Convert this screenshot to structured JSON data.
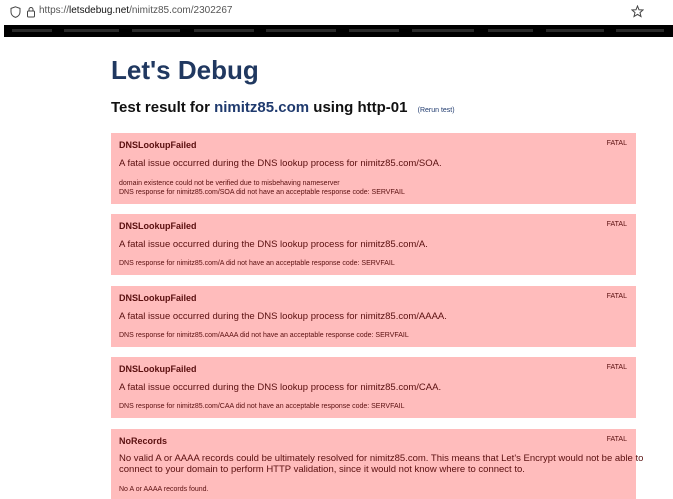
{
  "browser": {
    "url_prefix": "https://",
    "url_host": "letsdebug.net",
    "url_path": "/nimitz85.com/2302267"
  },
  "page": {
    "title": "Let's Debug",
    "subtitle_prefix": "Test result for",
    "domain": "nimitz85.com",
    "subtitle_suffix": "using http-01",
    "rerun_label": "(Rerun test)"
  },
  "problems": [
    {
      "name": "DNSLookupFailed",
      "severity": "FATAL",
      "message": "A fatal issue occurred during the DNS lookup process for nimitz85.com/SOA.",
      "details": [
        "domain existence could not be verified due to misbehaving nameserver",
        "DNS response for nimitz85.com/SOA did not have an acceptable response code: SERVFAIL"
      ]
    },
    {
      "name": "DNSLookupFailed",
      "severity": "FATAL",
      "message": "A fatal issue occurred during the DNS lookup process for nimitz85.com/A.",
      "details": [
        "DNS response for nimitz85.com/A did not have an acceptable response code: SERVFAIL"
      ]
    },
    {
      "name": "DNSLookupFailed",
      "severity": "FATAL",
      "message": "A fatal issue occurred during the DNS lookup process for nimitz85.com/AAAA.",
      "details": [
        "DNS response for nimitz85.com/AAAA did not have an acceptable response code: SERVFAIL"
      ]
    },
    {
      "name": "DNSLookupFailed",
      "severity": "FATAL",
      "message": "A fatal issue occurred during the DNS lookup process for nimitz85.com/CAA.",
      "details": [
        "DNS response for nimitz85.com/CAA did not have an acceptable response code: SERVFAIL"
      ]
    },
    {
      "name": "NoRecords",
      "severity": "FATAL",
      "message_lines": [
        "No valid A or AAAA records could be ultimately resolved for nimitz85.com. This means that Let's Encrypt would not be able to",
        "connect to your domain to perform HTTP validation, since it would not know where to connect to."
      ],
      "details": [
        "No A or AAAA records found."
      ]
    }
  ]
}
